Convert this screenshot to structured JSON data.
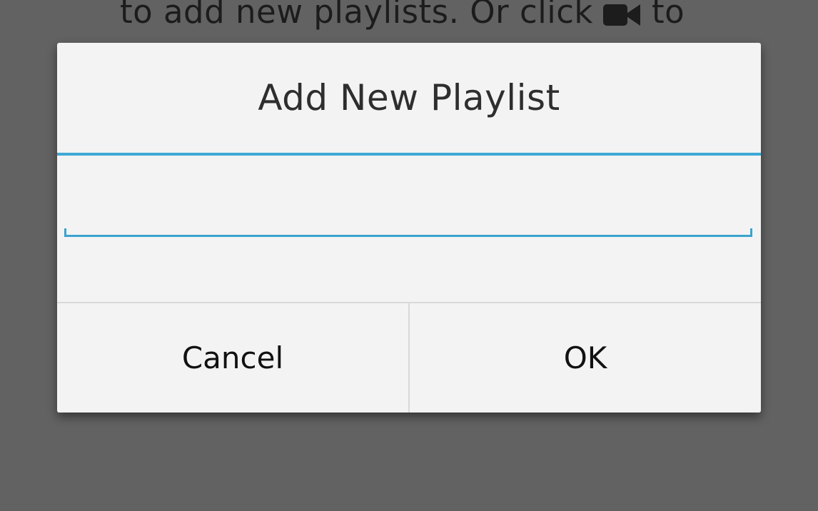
{
  "background": {
    "hint_part1": "to add new playlists. Or click",
    "hint_icon": "video-camera-icon",
    "hint_part2": "to"
  },
  "dialog": {
    "title": "Add New Playlist",
    "input": {
      "value": "",
      "placeholder": ""
    },
    "cancel_label": "Cancel",
    "ok_label": "OK"
  },
  "colors": {
    "accent": "#3fa9d4",
    "overlay": "#626262",
    "dialog_bg": "#f3f3f3"
  }
}
